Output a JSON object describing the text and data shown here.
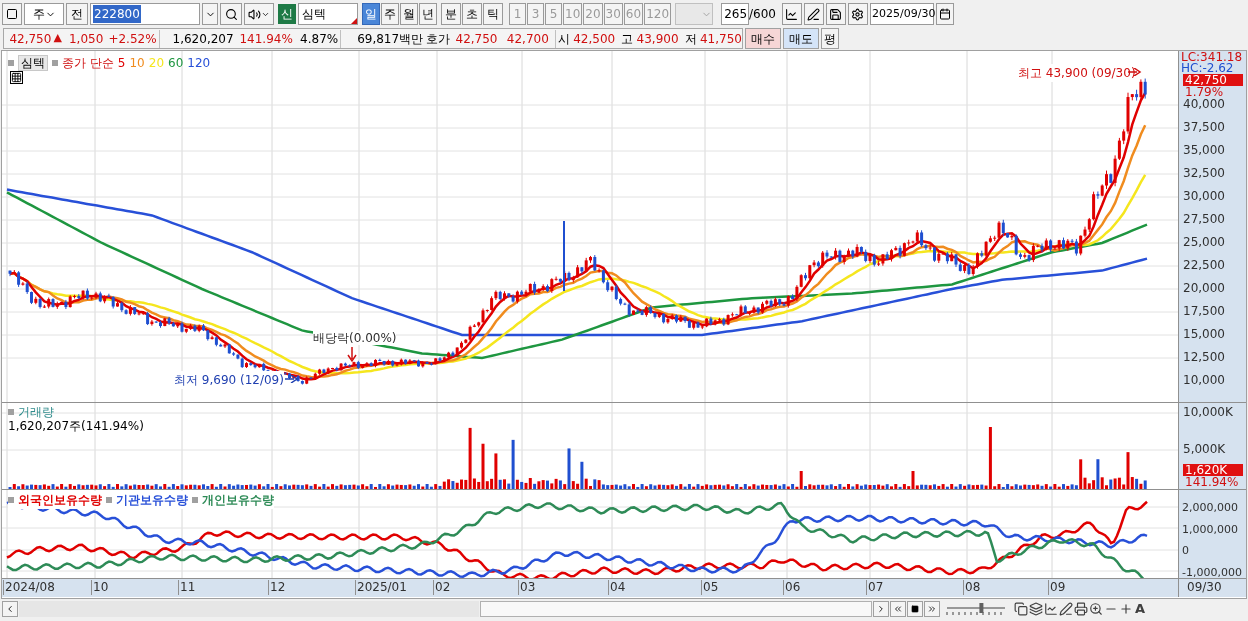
{
  "toolbar": {
    "period_unit": "주",
    "prev_button": "전",
    "code": "222800",
    "market_badge": "신",
    "stock_name": "심텍",
    "periods": [
      {
        "label": "일",
        "selected": true
      },
      {
        "label": "주",
        "selected": false
      },
      {
        "label": "월",
        "selected": false
      },
      {
        "label": "년",
        "selected": false
      }
    ],
    "intraday": [
      "분",
      "초",
      "틱"
    ],
    "intervals": [
      "1",
      "3",
      "5",
      "10",
      "20",
      "30",
      "60",
      "120"
    ],
    "count": "265",
    "count_max": "/600",
    "date": "2025/09/30"
  },
  "quote": {
    "price": "42,750",
    "direction": "▲",
    "change": "1,050",
    "change_rate": "+2.52%",
    "volume": "1,620,207",
    "volume_ratio": "141.94%",
    "turnover": "4.87%",
    "market_cap": "69,817백만",
    "ask_label": "호가",
    "ask": "42,750",
    "bid": "42,700",
    "open_label": "시",
    "open": "42,500",
    "high_label": "고",
    "high": "43,900",
    "low_label": "저",
    "low": "41,750",
    "buttons": [
      {
        "label": "매수",
        "kind": "buy"
      },
      {
        "label": "매도",
        "kind": "sell"
      },
      {
        "label": "평",
        "kind": "plain"
      }
    ]
  },
  "price_pane": {
    "stock_tag": "심텍",
    "legend_title": "종가 단순",
    "averages": [
      {
        "label": "5",
        "color": "#e00000"
      },
      {
        "label": "10",
        "color": "#f08c1e"
      },
      {
        "label": "20",
        "color": "#f5e61e"
      },
      {
        "label": "60",
        "color": "#1e9640"
      },
      {
        "label": "120",
        "color": "#2850d8"
      }
    ],
    "high_marker": "최고 43,900 (09/30)",
    "low_marker": "최저 9,690 (12/09)",
    "dividend_marker": "배당락(0.00%)",
    "lc": "LC:341.18",
    "hc": "HC:-2.62",
    "price_tag": "42,750",
    "price_tag_rate": "1.79%",
    "yticks": [
      "40,000",
      "37,500",
      "35,000",
      "32,500",
      "30,000",
      "27,500",
      "25,000",
      "22,500",
      "20,000",
      "17,500",
      "15,000",
      "12,500",
      "10,000"
    ]
  },
  "volume_pane": {
    "title": "거래량",
    "reading": "1,620,207주(141.94%)",
    "yticks": [
      "10,000K",
      "5,000K"
    ],
    "tag": "1,620K",
    "tag_rate": "141.94%"
  },
  "holdings_pane": {
    "series": [
      {
        "label": "외국인보유수량",
        "color": "#e00000"
      },
      {
        "label": "기관보유수량",
        "color": "#2850d8"
      },
      {
        "label": "개인보유수량",
        "color": "#2e8b57"
      }
    ],
    "yticks": [
      "2,000,000",
      "1,000,000",
      "0",
      "-1,000,000"
    ]
  },
  "x_axis": {
    "labels": [
      "2024/08",
      "10",
      "11",
      "12",
      "2025/01",
      "02",
      "03",
      "04",
      "05",
      "06",
      "07",
      "08",
      "09"
    ],
    "current": "09/30"
  },
  "bottom_bar": {
    "font_button": "A",
    "zoom_slider": {
      "level": 0.6
    }
  }
}
